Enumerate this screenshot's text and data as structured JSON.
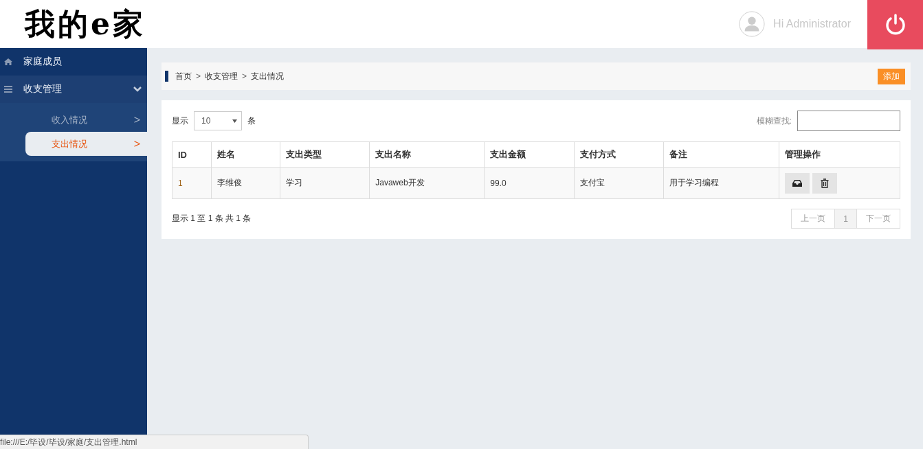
{
  "header": {
    "logo": "我的e家",
    "greeting": "Hi Administrator"
  },
  "sidebar": {
    "items": [
      {
        "label": "家庭成员",
        "kind": "link"
      },
      {
        "label": "收支管理",
        "kind": "group",
        "expanded": true,
        "children": [
          {
            "label": "收入情况",
            "arrow": ">",
            "selected": false
          },
          {
            "label": "支出情况",
            "arrow": ">",
            "selected": true
          }
        ]
      }
    ]
  },
  "breadcrumb": [
    "首页",
    "收支管理",
    "支出情况"
  ],
  "breadcrumb_separator": ">",
  "add_button": "添加",
  "controls": {
    "show_label": "显示",
    "page_length": "10",
    "unit_label": "条",
    "search_label": "模糊查找:"
  },
  "table": {
    "columns": [
      "ID",
      "姓名",
      "支出类型",
      "支出名称",
      "支出金额",
      "支付方式",
      "备注",
      "管理操作"
    ],
    "rows": [
      {
        "cells": [
          "1",
          "李维俊",
          "学习",
          "Javaweb开发",
          "99.0",
          "支付宝",
          "用于学习编程"
        ]
      }
    ]
  },
  "info": "显示 1 至 1 条 共 1 条",
  "pagination": [
    {
      "label": "上一页",
      "selected": false
    },
    {
      "label": "1",
      "selected": true
    },
    {
      "label": "下一页",
      "selected": false
    }
  ],
  "status_bar": "file:///E:/毕设/毕设/家庭/支出管理.html"
}
